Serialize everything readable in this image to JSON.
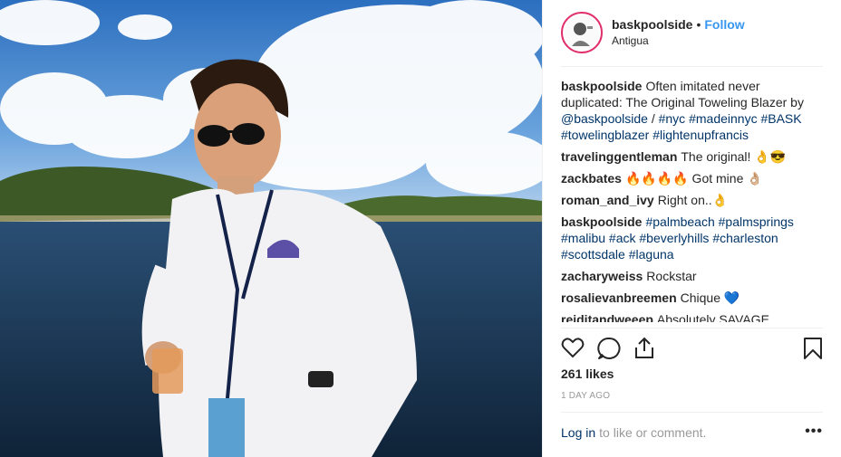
{
  "post": {
    "username": "baskpoolside",
    "dot": "•",
    "follow_label": "Follow",
    "location": "Antigua",
    "likes": "261 likes",
    "time": "1 DAY AGO",
    "login_label": "Log in",
    "login_suffix": "to like or comment.",
    "more_label": "•••"
  },
  "comments": [
    {
      "user": "baskpoolside",
      "parts": [
        {
          "t": "Often imitated never duplicated: The Original Toweling Blazer by "
        },
        {
          "t": "@baskpoolside",
          "tag": true
        },
        {
          "t": " / "
        },
        {
          "t": "#nyc",
          "tag": true
        },
        {
          "t": " "
        },
        {
          "t": "#madeinnyc",
          "tag": true
        },
        {
          "t": " "
        },
        {
          "t": "#BASK",
          "tag": true
        },
        {
          "t": " "
        },
        {
          "t": "#towelingblazer",
          "tag": true
        },
        {
          "t": " "
        },
        {
          "t": "#lightenupfrancis",
          "tag": true
        }
      ]
    },
    {
      "user": "travelinggentleman",
      "parts": [
        {
          "t": "The original! 👌😎"
        }
      ]
    },
    {
      "user": "zackbates",
      "parts": [
        {
          "t": "🔥🔥🔥🔥 Got mine 👌🏼"
        }
      ]
    },
    {
      "user": "roman_and_ivy",
      "parts": [
        {
          "t": "Right on..👌"
        }
      ]
    },
    {
      "user": "baskpoolside",
      "parts": [
        {
          "t": "#palmbeach",
          "tag": true
        },
        {
          "t": " "
        },
        {
          "t": "#palmsprings",
          "tag": true
        },
        {
          "t": " "
        },
        {
          "t": "#malibu",
          "tag": true
        },
        {
          "t": " "
        },
        {
          "t": "#ack",
          "tag": true
        },
        {
          "t": " "
        },
        {
          "t": "#beverlyhills",
          "tag": true
        },
        {
          "t": " "
        },
        {
          "t": "#charleston",
          "tag": true
        },
        {
          "t": " "
        },
        {
          "t": "#scottsdale",
          "tag": true
        },
        {
          "t": " "
        },
        {
          "t": "#laguna",
          "tag": true
        }
      ]
    },
    {
      "user": "zacharyweiss",
      "parts": [
        {
          "t": "Rockstar"
        }
      ]
    },
    {
      "user": "rosalievanbreemen",
      "parts": [
        {
          "t": "Chique 💙"
        }
      ]
    },
    {
      "user": "reiditandweeep",
      "parts": [
        {
          "t": "Absolutely SAVAGE takedown"
        }
      ]
    }
  ],
  "icons": {
    "like": "heart-icon",
    "comment": "comment-icon",
    "share": "share-icon",
    "save": "bookmark-icon"
  },
  "colors": {
    "accent": "#3897f0",
    "hashtag": "#003569",
    "muted": "#999999",
    "avatar_ring": "#e1306c"
  }
}
